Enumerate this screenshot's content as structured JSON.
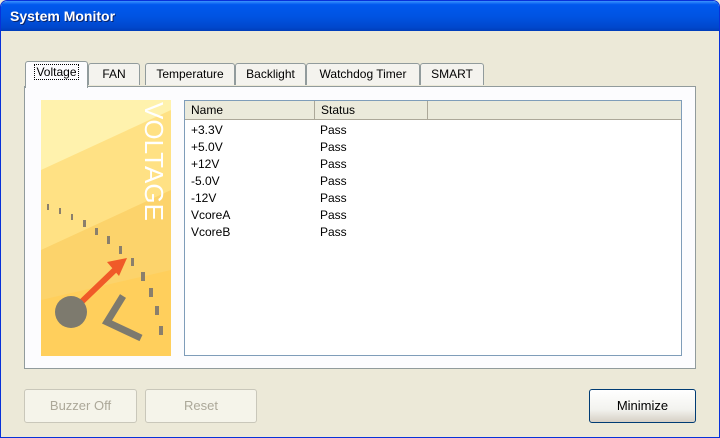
{
  "window": {
    "title": "System Monitor"
  },
  "tabs": [
    {
      "label": "Voltage",
      "active": true
    },
    {
      "label": "FAN",
      "active": false
    },
    {
      "label": "Temperature",
      "active": false
    },
    {
      "label": "Backlight",
      "active": false
    },
    {
      "label": "Watchdog Timer",
      "active": false
    },
    {
      "label": "SMART",
      "active": false
    }
  ],
  "panel": {
    "art_text": "VOLTAGE",
    "art_icon": "voltage-gauge-icon",
    "columns": [
      "Name",
      "Status"
    ],
    "rows": [
      {
        "name": "+3.3V",
        "status": "Pass"
      },
      {
        "name": "+5.0V",
        "status": "Pass"
      },
      {
        "name": "+12V",
        "status": "Pass"
      },
      {
        "name": "-5.0V",
        "status": "Pass"
      },
      {
        "name": "-12V",
        "status": "Pass"
      },
      {
        "name": "VcoreA",
        "status": "Pass"
      },
      {
        "name": "VcoreB",
        "status": "Pass"
      }
    ]
  },
  "buttons": {
    "buzzer_off": "Buzzer Off",
    "reset": "Reset",
    "minimize": "Minimize"
  },
  "colors": {
    "titlebar": "#0054e3",
    "face": "#ece9d8",
    "gauge_needle": "#f05a28"
  }
}
